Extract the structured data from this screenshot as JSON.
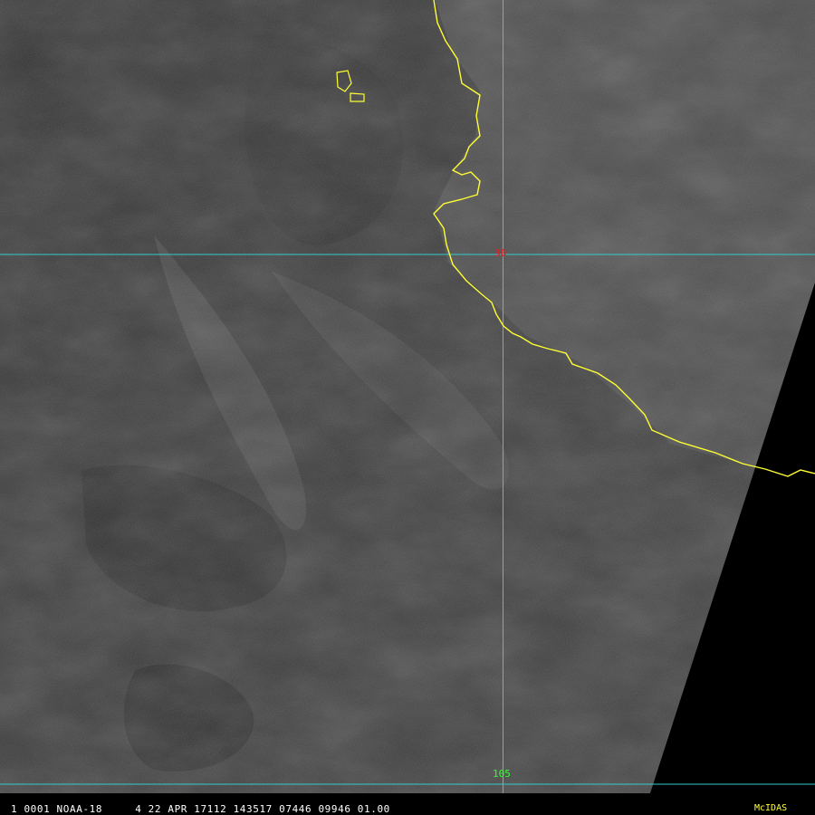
{
  "status_bar": {
    "text": "1 0001 NOAA-18     4 22 APR 17112 143517 07446 09946 01.00",
    "brand": "McIDAS"
  },
  "grid": {
    "lat_label": "30",
    "lon_label": "105"
  },
  "colors": {
    "coastline": "#ffff33",
    "gridline": "#33cccc",
    "lat_label": "#cc2a2a",
    "lon_label": "#33ff33",
    "background": "#3a3a3a",
    "no_data": "#000000"
  },
  "colorbar": [
    "#151515",
    "#222222",
    "#2e2e2e",
    "#3a3a3a",
    "#474747",
    "#555555",
    "#636363",
    "#727272",
    "#818181",
    "#909090",
    "#a0a0a0",
    "#b0b0b0",
    "#c0c0c0",
    "#d0d0d0",
    "#e0e0e0",
    "#f5f5f5",
    "#c8f5f5",
    "#a8e0e0",
    "#8a8a8a",
    "#6e6e6e",
    "#505050",
    "#0000c8",
    "#00c800",
    "#008800",
    "#b40000",
    "#ee0000",
    "#eeee00",
    "#b4b400",
    "#ffffff",
    "#c8c8c8",
    "#000080",
    "#000040"
  ]
}
